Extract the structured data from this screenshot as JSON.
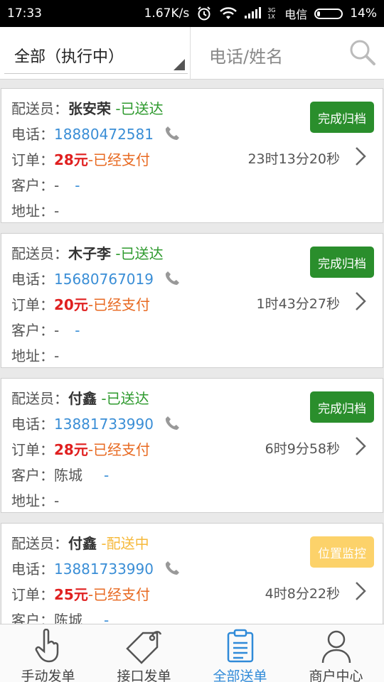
{
  "status_bar": {
    "time": "17:33",
    "speed": "1.67K/s",
    "network_type": "3G 1X",
    "carrier": "电信",
    "battery": "14%"
  },
  "filter": {
    "selected": "全部（执行中）",
    "search_placeholder": "电话/姓名"
  },
  "labels": {
    "courier": "配送员：",
    "phone": "电话：",
    "order": "订单：",
    "customer": "客户：",
    "address": "地址："
  },
  "orders": [
    {
      "courier": "张安荣",
      "status": "-已送达",
      "status_type": "done",
      "phone": "18880472581",
      "price": "28元",
      "pay_status": "-已经支付",
      "timer": "23时13分20秒",
      "customer_name": "-",
      "customer_dash": "-",
      "address": "-",
      "action": "完成归档",
      "action_color": "#2a8e2c"
    },
    {
      "courier": "木子李",
      "status": "-已送达",
      "status_type": "done",
      "phone": "15680767019",
      "price": "20元",
      "pay_status": "-已经支付",
      "timer": "1时43分27秒",
      "customer_name": "-",
      "customer_dash": "-",
      "address": "-",
      "action": "完成归档",
      "action_color": "#2a8e2c"
    },
    {
      "courier": "付鑫",
      "status": "-已送达",
      "status_type": "done",
      "phone": "13881733990",
      "price": "28元",
      "pay_status": "-已经支付",
      "timer": "6时9分58秒",
      "customer_name": "陈城",
      "customer_dash": "-",
      "address": "-",
      "action": "完成归档",
      "action_color": "#2a8e2c"
    },
    {
      "courier": "付鑫",
      "status": "-配送中",
      "status_type": "delivering",
      "phone": "13881733990",
      "price": "25元",
      "pay_status": "-已经支付",
      "timer": "4时8分22秒",
      "customer_name": "陈城",
      "customer_dash": "-",
      "action": "位置监控",
      "action_color": "#fcd26a"
    }
  ],
  "nav": [
    {
      "label": "手动发单",
      "icon": "hand-pointer-icon",
      "active": false
    },
    {
      "label": "接口发单",
      "icon": "tag-icon",
      "active": false
    },
    {
      "label": "全部送单",
      "icon": "clipboard-list-icon",
      "active": true
    },
    {
      "label": "商户中心",
      "icon": "user-icon",
      "active": false
    }
  ],
  "colors": {
    "done": "#2e9a2e",
    "delivering": "#f6b93b",
    "phone": "#3a8ed6",
    "price": "#e02020",
    "paid": "#e86a22",
    "active_tab": "#2f8ad8"
  }
}
